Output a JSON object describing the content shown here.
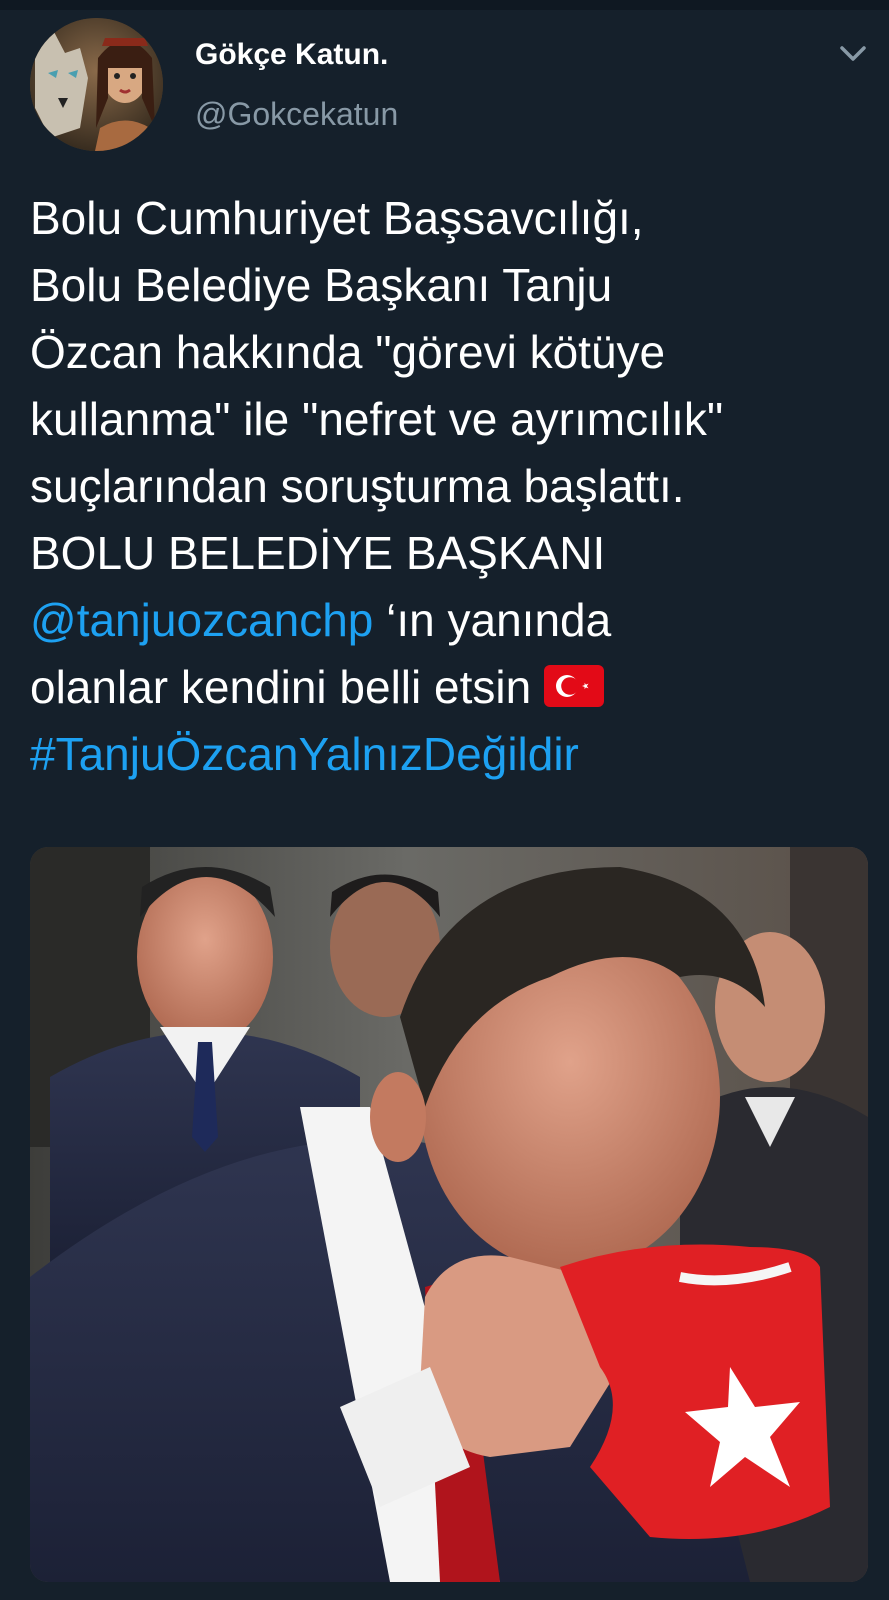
{
  "author": {
    "display_name": "Gökçe Katun.",
    "handle": "@Gokcekatun"
  },
  "tweet": {
    "line_1": "Bolu Cumhuriyet Başsavcılığı,",
    "line_2": "Bolu Belediye Başkanı Tanju",
    "line_3": "Özcan hakkında \"görevi kötüye",
    "line_4": "kullanma\" ile \"nefret ve ayrımcılık\"",
    "line_5": "suçlarından soruşturma başlattı.",
    "line_6": "BOLU BELEDİYE BAŞKANI",
    "mention": "@tanjuozcanchp",
    "line_7_rest": " ‘ın yanında",
    "line_8": "olanlar kendini belli etsin ",
    "hashtag": "#TanjuÖzcanYalnızDeğildir"
  },
  "icons": {
    "more": "chevron-down-icon",
    "emoji": "turkish-flag-emoji"
  },
  "colors": {
    "background": "#15202b",
    "text": "#ffffff",
    "secondary_text": "#8899a6",
    "link": "#1da1f2",
    "flag_red": "#e30a17"
  }
}
